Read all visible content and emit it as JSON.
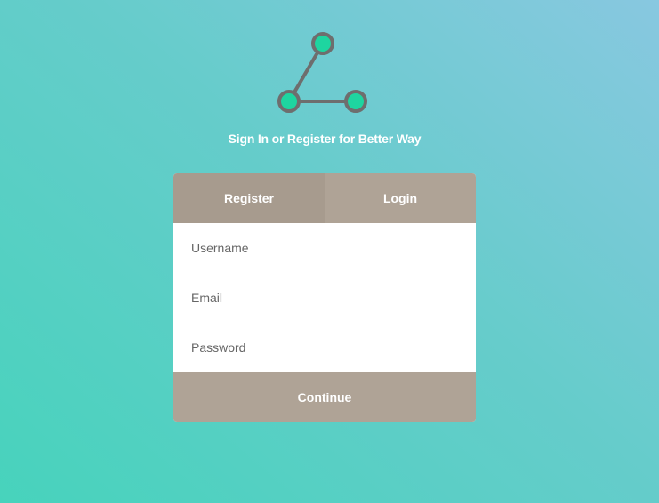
{
  "brand": {
    "logo_icon": "network-nodes-icon",
    "tagline": "Sign In or Register for Better Way"
  },
  "tabs": [
    {
      "label": "Register",
      "active": true
    },
    {
      "label": "Login",
      "active": false
    }
  ],
  "form": {
    "username_placeholder": "Username",
    "email_placeholder": "Email",
    "password_placeholder": "Password",
    "submit_label": "Continue"
  },
  "colors": {
    "background_start": "#47d3bc",
    "background_end": "#88c8e0",
    "node_fill": "#1ed5a0",
    "node_stroke": "#6e6e6e",
    "tab_active": "#a79b8e",
    "tab_inactive": "#afa396",
    "button": "#afa396"
  }
}
